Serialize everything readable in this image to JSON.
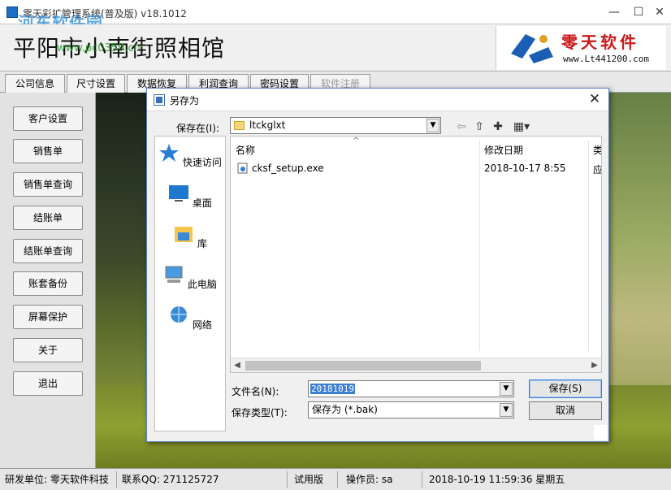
{
  "window": {
    "title": "零天彩扩管理系统(普及版)  v18.1012",
    "watermark": "河东软件园",
    "controls": [
      "—",
      "☐",
      "✕"
    ]
  },
  "header": {
    "store_name": "平阳市小南街照相馆",
    "url_watermark": "www.pc0359.cn",
    "logo_cn": "零天软件",
    "logo_url": "www.Lt441200.com"
  },
  "tabs": [
    {
      "label": "公司信息",
      "enabled": true
    },
    {
      "label": "尺寸设置",
      "enabled": true
    },
    {
      "label": "数据恢复",
      "enabled": true
    },
    {
      "label": "利润查询",
      "enabled": true
    },
    {
      "label": "密码设置",
      "enabled": true
    },
    {
      "label": "软件注册",
      "enabled": false
    }
  ],
  "sidebar": {
    "buttons": [
      "客户设置",
      "销售单",
      "销售单查询",
      "结账单",
      "结账单查询",
      "账套备份",
      "屏幕保护",
      "关于",
      "退出"
    ]
  },
  "dialog": {
    "title": "另存为",
    "save_in_label": "保存在(I):",
    "save_in_value": "ltckglxt",
    "places": [
      {
        "label": "快速访问",
        "icon": "star-icon"
      },
      {
        "label": "桌面",
        "icon": "desktop-icon"
      },
      {
        "label": "库",
        "icon": "library-icon"
      },
      {
        "label": "此电脑",
        "icon": "computer-icon"
      },
      {
        "label": "网络",
        "icon": "network-icon"
      }
    ],
    "columns": {
      "name": "名称",
      "date": "修改日期",
      "type": "类"
    },
    "files": [
      {
        "name": "cksf_setup.exe",
        "date": "2018-10-17 8:55",
        "type": "应"
      }
    ],
    "filename_label": "文件名(N):",
    "filename_value": "20181019",
    "filetype_label": "保存类型(T):",
    "filetype_value": "保存为 (*.bak)",
    "save_button": "保存(S)",
    "cancel_button": "取消"
  },
  "status": {
    "developer": "研发单位: 零天软件科技",
    "contact": "联系QQ: 271125727",
    "edition": "试用版",
    "operator": "操作员: sa",
    "datetime": "2018-10-19 11:59:36 星期五"
  }
}
